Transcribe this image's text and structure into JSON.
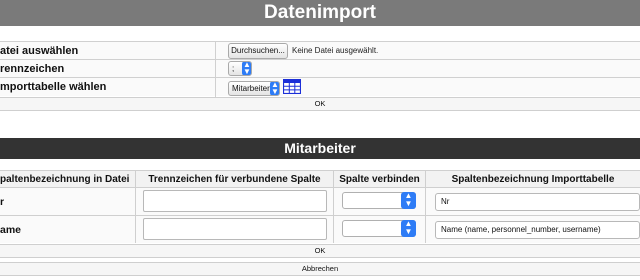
{
  "header": {
    "title": "Datenimport"
  },
  "form": {
    "file_label": "atei auswählen",
    "file_button": "Durchsuchen...",
    "file_status": "Keine Datei ausgewählt.",
    "separator_label": "rennzeichen",
    "separator_value": ";",
    "table_label": "mporttabelle wählen",
    "table_value": "Mitarbeiter",
    "ok_label": "OK"
  },
  "section": {
    "title": "Mitarbeiter"
  },
  "mapping_table": {
    "headers": [
      "paltenbezeichnung in Datei",
      "Trennzeichen für verbundene Spalte",
      "Spalte verbinden",
      "Spaltenbezeichnung Importtabelle"
    ],
    "rows": [
      {
        "file_column": "r",
        "separator": "",
        "connect": "",
        "target": "Nr"
      },
      {
        "file_column": "ame",
        "separator": "",
        "connect": "",
        "target": "Name (name, personnel_number, username)"
      }
    ]
  },
  "footer": {
    "ok_label": "OK",
    "cancel_label": "Abbrechen"
  },
  "colors": {
    "header_bg": "#7a7a7a",
    "section_bg": "#333333",
    "accent": "#2e7cf6",
    "table_icon": "#1c2fd8"
  },
  "icons": {
    "select_arrow": "chevron-updown-icon",
    "table_icon": "table-grid-icon"
  }
}
